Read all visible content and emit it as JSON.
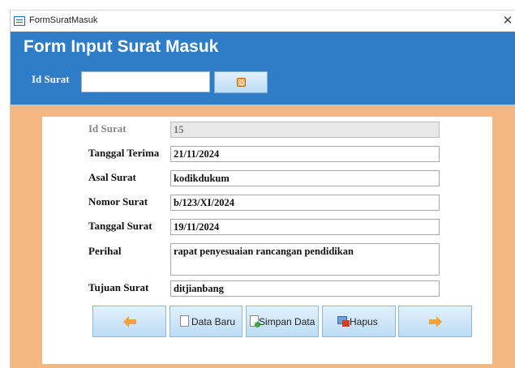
{
  "window": {
    "title": "FormSuratMasuk",
    "close_label": "✕"
  },
  "header": {
    "form_title": "Form Input Surat Masuk",
    "id_label": "Id Surat",
    "search_value": ""
  },
  "fields": {
    "id_surat": {
      "label": "Id Surat",
      "value": "15"
    },
    "tanggal_terima": {
      "label": "Tanggal Terima",
      "value": "21/11/2024"
    },
    "asal_surat": {
      "label": "Asal Surat",
      "value": "kodikdukum"
    },
    "nomor_surat": {
      "label": "Nomor Surat",
      "value": "b/123/XI/2024"
    },
    "tanggal_surat": {
      "label": "Tanggal Surat",
      "value": "19/11/2024"
    },
    "perihal": {
      "label": "Perihal",
      "value": "rapat penyesuaian rancangan pendidikan"
    },
    "tujuan_surat": {
      "label": "Tujuan Surat",
      "value": "ditjianbang"
    }
  },
  "buttons": {
    "data_baru": "Data Baru",
    "simpan_data": "Simpan Data",
    "hapus": "Hapus"
  },
  "colors": {
    "header": "#2f7cc7",
    "detail_background": "#f4b983",
    "button_fill": "#c7e3f8",
    "arrow": "#f6a235"
  },
  "icons": [
    "app-form-icon",
    "close-icon",
    "search-icon",
    "arrow-left-icon",
    "new-document-icon",
    "save-document-icon",
    "delete-icon",
    "arrow-right-icon"
  ]
}
